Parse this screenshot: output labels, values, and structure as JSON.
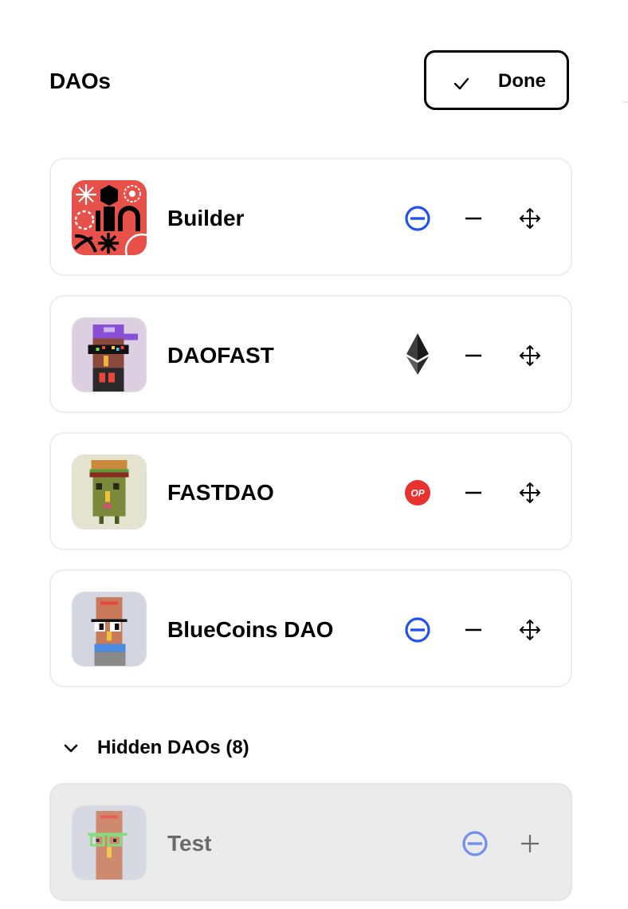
{
  "header": {
    "title": "DAOs",
    "done_label": "Done"
  },
  "daos": [
    {
      "name": "Builder",
      "chain_icon": "base-icon"
    },
    {
      "name": "DAOFAST",
      "chain_icon": "ethereum-icon"
    },
    {
      "name": "FASTDAO",
      "chain_icon": "optimism-icon",
      "chain_text": "OP"
    },
    {
      "name": "BlueCoins DAO",
      "chain_icon": "base-icon"
    }
  ],
  "hidden_section": {
    "label": "Hidden DAOs (8)",
    "items": [
      {
        "name": "Test",
        "chain_icon": "base-icon"
      }
    ]
  },
  "colors": {
    "base_blue": "#2251f0",
    "optimism_red": "#e8322f",
    "builder_red": "#e8504a"
  }
}
